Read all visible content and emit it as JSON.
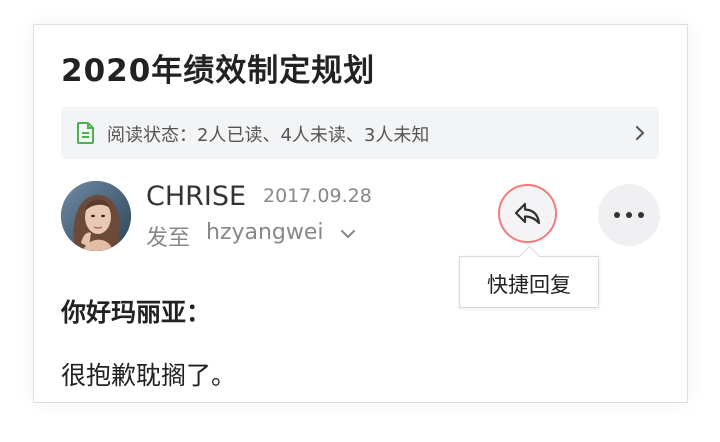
{
  "email": {
    "subject": "2020年绩效制定规划",
    "read_status": {
      "text": "阅读状态：2人已读、4人未读、3人未知",
      "icon": "document-icon",
      "action_icon": "chevron-right-icon"
    },
    "sender": {
      "name": "CHRISE",
      "date": "2017.09.28",
      "send_to_label": "发至",
      "recipient": "hzyangwei",
      "avatar": "avatar-photo"
    },
    "actions": {
      "reply_icon": "reply-icon",
      "reply_tooltip": "快捷回复",
      "more_icon": "more-icon"
    },
    "body": {
      "greeting": "你好玛丽亚：",
      "line1": "很抱歉耽搁了。"
    }
  },
  "colors": {
    "accent_green": "#4caf50",
    "reply_ring": "#f07c7c",
    "status_bg": "#f3f4f6"
  }
}
